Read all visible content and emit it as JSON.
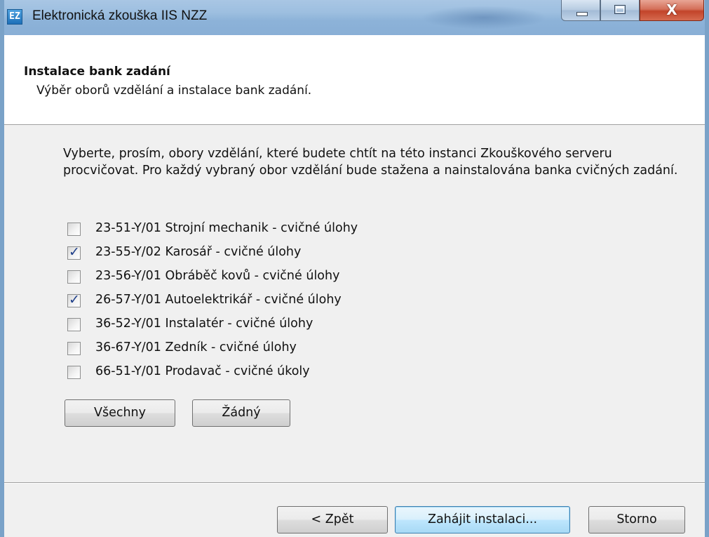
{
  "window": {
    "icon_label": "EZ",
    "title": "Elektronická zkouška IIS NZZ",
    "caption_buttons": {
      "minimize_icon": "minimize-icon",
      "maximize_icon": "maximize-icon",
      "close_glyph": "X"
    }
  },
  "header": {
    "title": "Instalace bank zadání",
    "subtitle": "Výběr oborů vzdělání a instalace bank zadání."
  },
  "instructions": "Vyberte, prosím, obory vzdělání, které budete chtít na této instanci Zkouškového serveru procvičovat. Pro každý vybraný obor vzdělání bude stažena a nainstalována banka cvičných zadání.",
  "fields": [
    {
      "label": "23-51-Y/01 Strojní mechanik -  cvičné úlohy",
      "checked": false
    },
    {
      "label": "23-55-Y/02 Karosář - cvičné úlohy",
      "checked": true
    },
    {
      "label": "23-56-Y/01 Obráběč kovů - cvičné úlohy",
      "checked": false
    },
    {
      "label": "26-57-Y/01 Autoelektrikář - cvičné úlohy",
      "checked": true
    },
    {
      "label": "36-52-Y/01 Instalatér - cvičné úlohy",
      "checked": false
    },
    {
      "label": "36-67-Y/01 Zedník - cvičné úlohy",
      "checked": false
    },
    {
      "label": "66-51-Y/01 Prodavač - cvičné úkoly",
      "checked": false
    }
  ],
  "selection_buttons": {
    "all_label": "Všechny",
    "none_label": "Žádný"
  },
  "footer": {
    "back_label": "< Zpět",
    "install_label": "Zahájit instalaci...",
    "cancel_label": "Storno"
  },
  "colors": {
    "titlebar": "#9dbfe0",
    "header_bg": "#ffffff",
    "body_bg": "#f0f0f0",
    "check_mark": "#1e3f8a",
    "default_button_border": "#3c7fb1"
  }
}
